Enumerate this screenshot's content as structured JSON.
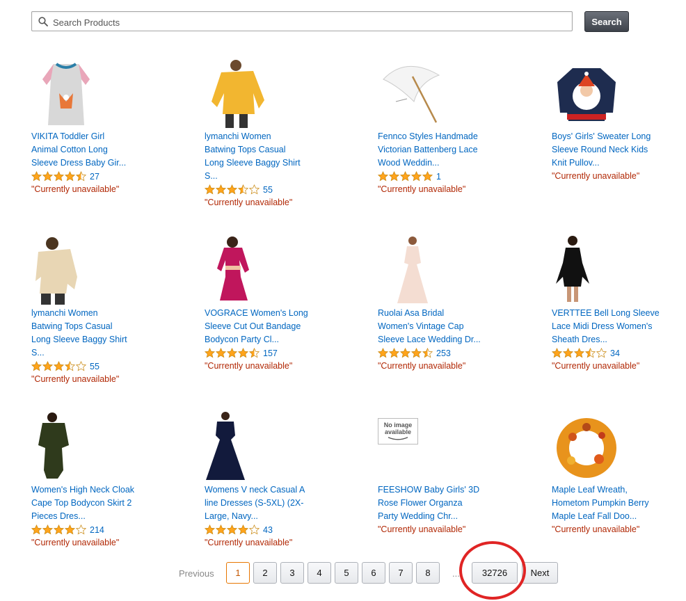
{
  "search": {
    "placeholder": "Search Products",
    "value": "",
    "button_label": "Search"
  },
  "products": [
    {
      "title_lines": [
        "VIKITA Toddler Girl",
        "Animal Cotton Long",
        "Sleeve Dress Baby Gir..."
      ],
      "rating": 4.5,
      "count": "27",
      "availability": "\"Currently unavailable\"",
      "image": "dress-fox"
    },
    {
      "title_lines": [
        "lymanchi Women",
        "Batwing Tops Casual",
        "Long Sleeve Baggy Shirt",
        "S..."
      ],
      "rating": 3.5,
      "count": "55",
      "availability": "\"Currently unavailable\"",
      "image": "yellow-top"
    },
    {
      "title_lines": [
        "Fennco Styles Handmade",
        "Victorian Battenberg Lace",
        "Wood Weddin..."
      ],
      "rating": 5,
      "count": "1",
      "availability": "\"Currently unavailable\"",
      "image": "parasol"
    },
    {
      "title_lines": [
        "Boys' Girls' Sweater Long",
        "Sleeve Round Neck Kids",
        "Knit Pullov..."
      ],
      "rating": null,
      "count": "",
      "availability": "\"Currently unavailable\"",
      "image": "santa-sweater"
    },
    {
      "title_lines": [
        "lymanchi Women",
        "Batwing Tops Casual",
        "Long Sleeve Baggy Shirt",
        "S..."
      ],
      "rating": 3.5,
      "count": "55",
      "availability": "\"Currently unavailable\"",
      "image": "beige-top"
    },
    {
      "title_lines": [
        "VOGRACE Women's Long",
        "Sleeve Cut Out Bandage",
        "Bodycon Party Cl..."
      ],
      "rating": 4.5,
      "count": "157",
      "availability": "\"Currently unavailable\"",
      "image": "pink-dress"
    },
    {
      "title_lines": [
        "Ruolai Asa Bridal",
        "Women's Vintage Cap",
        "Sleeve Lace Wedding Dr..."
      ],
      "rating": 4.5,
      "count": "253",
      "availability": "\"Currently unavailable\"",
      "image": "wedding-dress"
    },
    {
      "title_lines": [
        "VERTTEE Bell Long Sleeve",
        "Lace Midi Dress Women's",
        "Sheath Dres..."
      ],
      "rating": 3.5,
      "count": "34",
      "availability": "\"Currently unavailable\"",
      "image": "black-dress"
    },
    {
      "title_lines": [
        "Women's High Neck Cloak",
        "Cape Top Bodycon Skirt 2",
        "Pieces Dres..."
      ],
      "rating": 4,
      "count": "214",
      "availability": "\"Currently unavailable\"",
      "image": "olive-dress"
    },
    {
      "title_lines": [
        "Womens V neck Casual A",
        "line Dresses (S-5XL) (2X-",
        "Large, Navy..."
      ],
      "rating": 4,
      "count": "43",
      "availability": "\"Currently unavailable\"",
      "image": "navy-dress"
    },
    {
      "title_lines": [
        "FEESHOW Baby Girls' 3D",
        "Rose Flower Organza",
        "Party Wedding Chr..."
      ],
      "rating": null,
      "count": "",
      "availability": "\"Currently unavailable\"",
      "image": "no-image",
      "no_image_text": [
        "No image",
        "available"
      ]
    },
    {
      "title_lines": [
        "Maple Leaf Wreath,",
        "Hometom Pumpkin Berry",
        "Maple Leaf Fall Doo..."
      ],
      "rating": null,
      "count": "",
      "availability": "\"Currently unavailable\"",
      "image": "wreath"
    }
  ],
  "pagination": {
    "previous_label": "Previous",
    "pages": [
      "1",
      "2",
      "3",
      "4",
      "5",
      "6",
      "7",
      "8"
    ],
    "active_page": "1",
    "ellipsis": "...",
    "last_page": "32726",
    "next_label": "Next"
  },
  "colors": {
    "link": "#0066c0",
    "unavailable": "#b12704",
    "star": "#ffa41c",
    "annotation": "#e02424"
  }
}
